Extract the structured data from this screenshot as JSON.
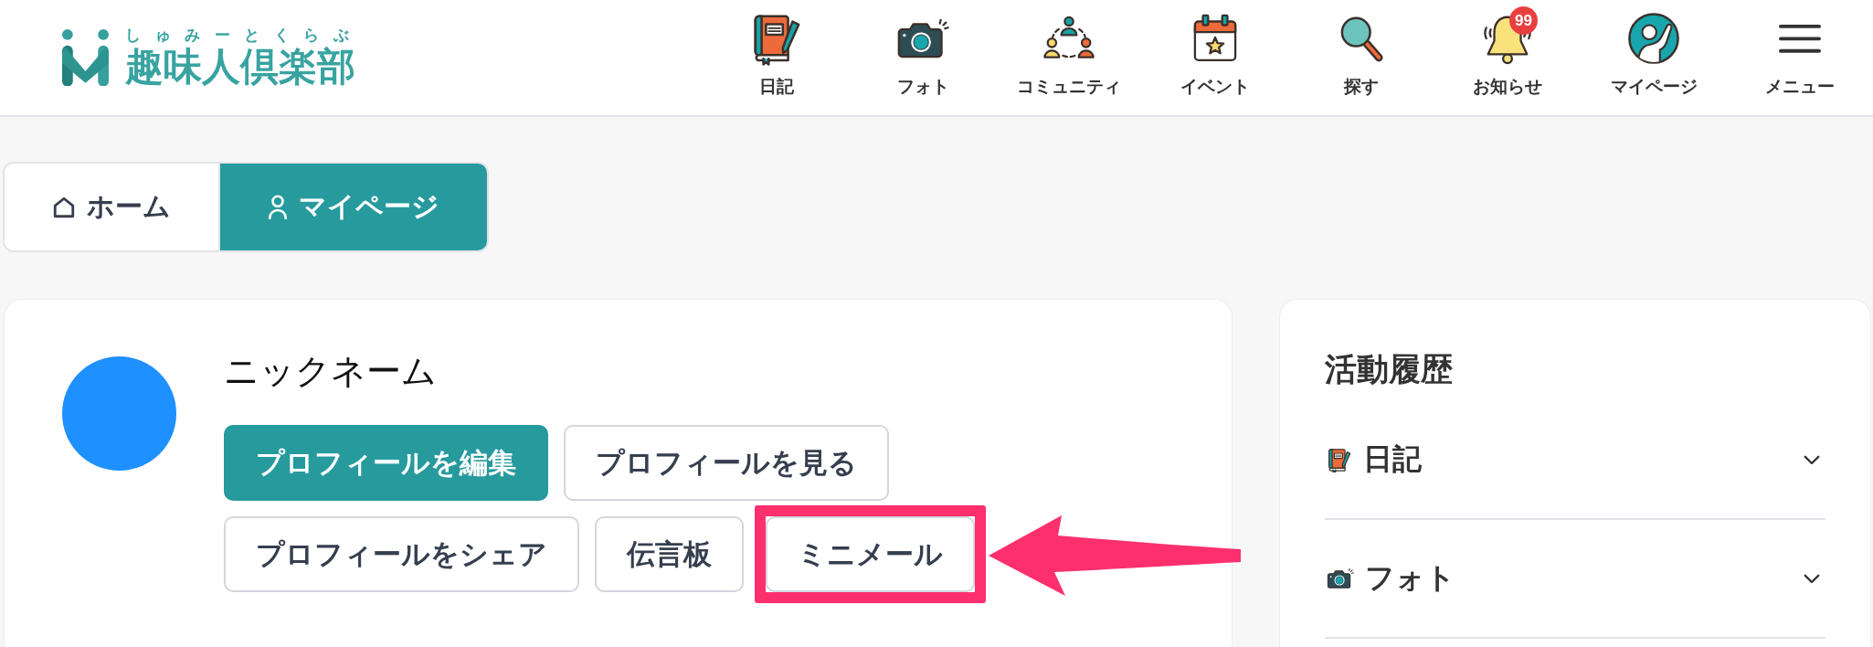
{
  "header": {
    "logo": {
      "reading": "しゅみーとくらぶ",
      "name": "趣味人倶楽部"
    },
    "nav": [
      {
        "kind": "diary",
        "label": "日記"
      },
      {
        "kind": "photo",
        "label": "フォト"
      },
      {
        "kind": "community",
        "label": "コミュニティ"
      },
      {
        "kind": "event",
        "label": "イベント"
      },
      {
        "kind": "search",
        "label": "探す"
      },
      {
        "kind": "notifications",
        "label": "お知らせ",
        "badge": "99"
      },
      {
        "kind": "mypage",
        "label": "マイページ"
      },
      {
        "kind": "menu",
        "label": "メニュー"
      }
    ]
  },
  "tabs": [
    {
      "kind": "home",
      "label": "ホーム",
      "selected": false
    },
    {
      "kind": "mypage",
      "label": "マイページ",
      "selected": true
    }
  ],
  "profile": {
    "nickname": "ニックネーム",
    "buttons": [
      {
        "label": "プロフィールを編集",
        "kind": "primary",
        "highlighted": false
      },
      {
        "label": "プロフィールを見る",
        "kind": "secondary",
        "highlighted": false
      },
      {
        "label": "プロフィールをシェア",
        "kind": "secondary",
        "highlighted": false
      },
      {
        "label": "伝言板",
        "kind": "secondary",
        "highlighted": false
      },
      {
        "label": "ミニメール",
        "kind": "secondary",
        "highlighted": true
      }
    ]
  },
  "activity": {
    "title": "活動履歴",
    "sections": [
      {
        "kind": "diary",
        "label": "日記",
        "expanded": false
      },
      {
        "kind": "photo",
        "label": "フォト",
        "expanded": false
      }
    ]
  }
}
